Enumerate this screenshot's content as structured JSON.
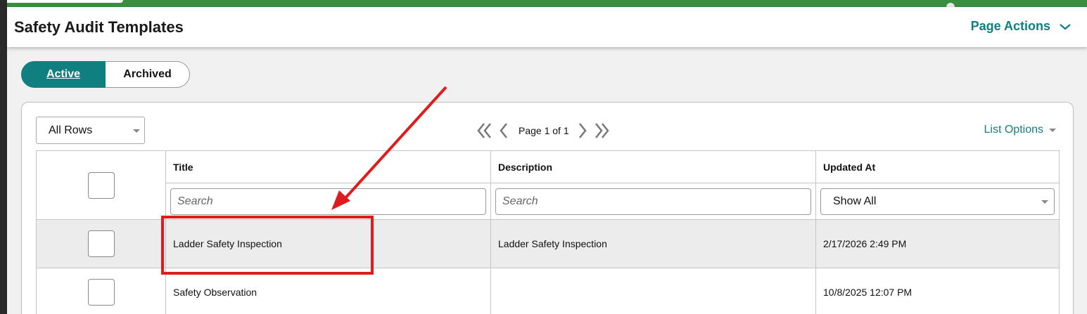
{
  "header": {
    "title": "Safety Audit Templates",
    "page_actions_label": "Page Actions"
  },
  "tabs": [
    {
      "label": "Active",
      "selected": true
    },
    {
      "label": "Archived",
      "selected": false
    }
  ],
  "toolbar": {
    "rows_select_value": "All Rows",
    "page_label": "Page 1 of 1",
    "list_options_label": "List Options"
  },
  "table": {
    "columns": [
      "Title",
      "Description",
      "Updated At"
    ],
    "filters": {
      "title_placeholder": "Search",
      "description_placeholder": "Search",
      "updated_at_value": "Show All"
    },
    "rows": [
      {
        "title": "Ladder Safety Inspection",
        "description": "Ladder Safety Inspection",
        "updated_at": "2/17/2026 2:49 PM"
      },
      {
        "title": "Safety Observation",
        "description": "",
        "updated_at": "10/8/2025 12:07 PM"
      }
    ]
  },
  "colors": {
    "accent": "#0f7f80",
    "topbar": "#3a8e3f",
    "annotation": "#e01b1b"
  },
  "icons": [
    "chevron-down-icon",
    "first-page-icon",
    "prev-page-icon",
    "next-page-icon",
    "last-page-icon",
    "caret-down-icon"
  ]
}
